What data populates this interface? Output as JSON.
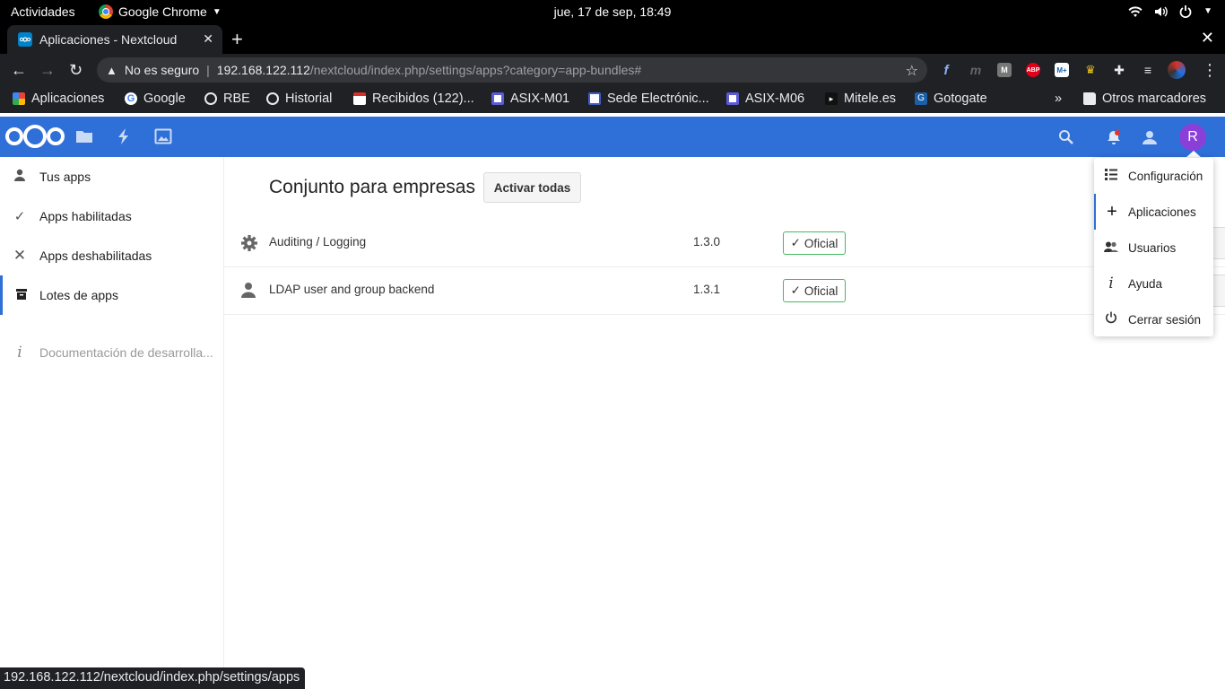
{
  "system": {
    "activities": "Actividades",
    "app_name": "Google Chrome",
    "clock": "jue, 17 de sep, 18:49"
  },
  "browser": {
    "tab_title": "Aplicaciones - Nextcloud",
    "security_label": "No es seguro",
    "url_host": "192.168.122.112",
    "url_path": "/nextcloud/index.php/settings/apps?category=app-bundles#",
    "extensions": [
      "fedora-icon",
      "m-icon",
      "m-gray-icon",
      "adblock-icon",
      "movistar-icon",
      "crown-icon",
      "puzzle-icon",
      "media-icon",
      "profile-icon"
    ],
    "bookmarks": [
      {
        "label": "Aplicaciones",
        "icon": "apps-grid-icon"
      },
      {
        "label": "Google",
        "icon": "google-icon"
      },
      {
        "label": "RBE",
        "icon": "globe-icon"
      },
      {
        "label": "Historial",
        "icon": "globe-icon"
      },
      {
        "label": "Recibidos (122)...",
        "icon": "gmail-icon"
      },
      {
        "label": "ASIX-M01",
        "icon": "moodle-icon"
      },
      {
        "label": "Sede Electrónic...",
        "icon": "sede-icon"
      },
      {
        "label": "ASIX-M06",
        "icon": "moodle-icon"
      },
      {
        "label": "Mitele.es",
        "icon": "mitele-icon"
      },
      {
        "label": "Gotogate",
        "icon": "gotogate-icon"
      }
    ],
    "more_bookmarks": "»",
    "other_bookmarks": "Otros marcadores",
    "status_url": "192.168.122.112/nextcloud/index.php/settings/apps"
  },
  "nextcloud": {
    "brand_color": "#2f6fd8",
    "avatar_letter": "R",
    "avatar_color": "#8b3fd9",
    "header_apps": [
      "files-icon",
      "activity-icon",
      "photos-icon"
    ],
    "sidebar": [
      {
        "label": "Tus apps",
        "icon": "user-icon"
      },
      {
        "label": "Apps habilitadas",
        "icon": "check-icon"
      },
      {
        "label": "Apps deshabilitadas",
        "icon": "close-icon"
      },
      {
        "label": "Lotes de apps",
        "icon": "archive-icon"
      },
      {
        "label": "Documentación de desarrolla...",
        "icon": "info-icon"
      }
    ],
    "bundle": {
      "title": "Conjunto para empresas",
      "activate_label": "Activar todas",
      "apps": [
        {
          "name": "Auditing / Logging",
          "version": "1.3.0",
          "badge": "Oficial",
          "icon": "gear-icon"
        },
        {
          "name": "LDAP user and group backend",
          "version": "1.3.1",
          "badge": "Oficial",
          "icon": "user-icon"
        }
      ]
    },
    "settings_menu": [
      {
        "label": "Configuración",
        "icon": "list-icon"
      },
      {
        "label": "Aplicaciones",
        "icon": "plus-icon"
      },
      {
        "label": "Usuarios",
        "icon": "users-icon"
      },
      {
        "label": "Ayuda",
        "icon": "info-icon"
      },
      {
        "label": "Cerrar sesión",
        "icon": "power-icon"
      }
    ]
  }
}
